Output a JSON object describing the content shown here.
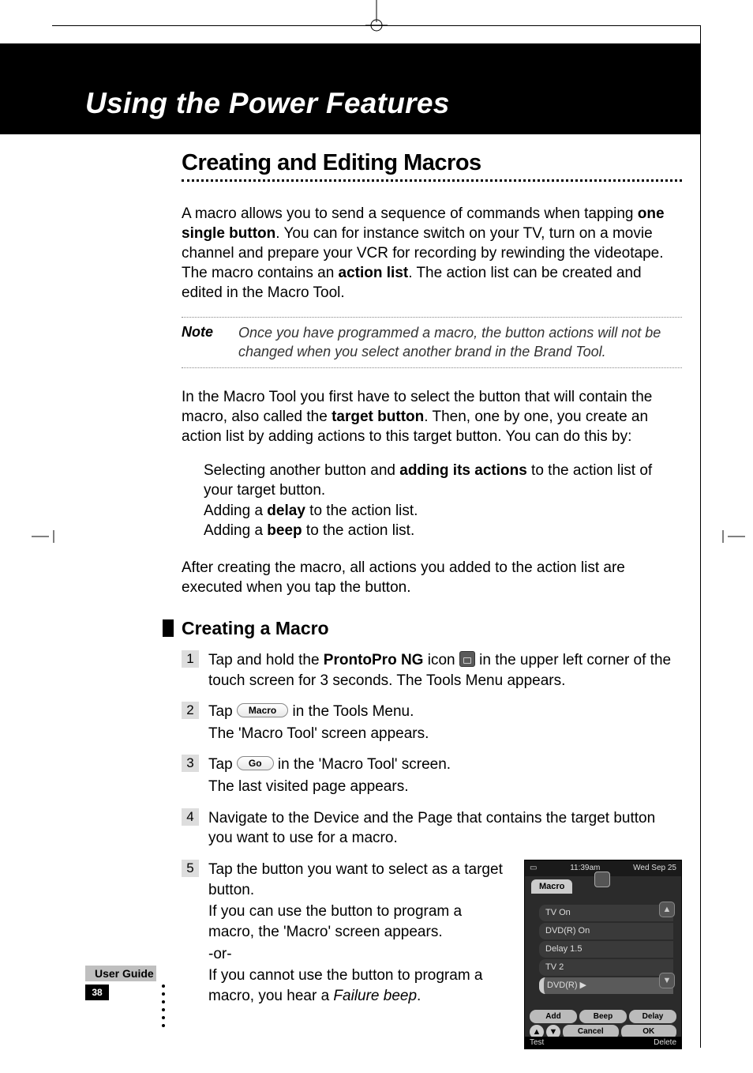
{
  "chapter_title": "Using the Power Features",
  "section_title": "Creating and Editing Macros",
  "intro": {
    "p1_a": "A macro allows you to send a sequence of commands when tapping ",
    "p1_b": "one single button",
    "p1_c": ". You can for instance switch on your TV, turn on a movie channel and prepare your VCR for recording by rewinding the videotape. The macro contains an ",
    "p1_d": "action list",
    "p1_e": ". The action list can be created and edited in the Macro Tool."
  },
  "note": {
    "label": "Note",
    "text": "Once you have programmed a macro, the button actions will not be changed when you select another brand in the Brand Tool."
  },
  "p2_a": "In the Macro Tool you first have to select the button that will contain the macro, also called the ",
  "p2_b": "target button",
  "p2_c": ". Then, one by one, you create an action list by adding actions to this target button. You can do this by:",
  "bullets": {
    "b1_a": "Selecting another button and ",
    "b1_b": "adding its actions",
    "b1_c": " to the action list of your target button.",
    "b2_a": "Adding a ",
    "b2_b": "delay",
    "b2_c": " to the action list.",
    "b3_a": "Adding a ",
    "b3_b": "beep",
    "b3_c": " to the action list."
  },
  "p3": "After creating the macro, all actions you added to the action list are executed when you tap the button.",
  "subheading": "Creating a Macro",
  "steps": {
    "s1": {
      "num": "1",
      "a": "Tap and hold the ",
      "b": "ProntoPro NG",
      "c": " icon ",
      "d": " in the upper left corner of the touch screen for 3 seconds.",
      "sub": " The Tools Menu appears."
    },
    "s2": {
      "num": "2",
      "a": "Tap ",
      "btn": "Macro",
      "b": " in the Tools Menu.",
      "sub": "The 'Macro Tool' screen appears."
    },
    "s3": {
      "num": "3",
      "a": "Tap ",
      "btn": "Go",
      "b": " in the 'Macro Tool' screen.",
      "sub": "The last visited page appears."
    },
    "s4": {
      "num": "4",
      "a": "Navigate to the Device and the Page that contains the target button you want to use for a macro."
    },
    "s5": {
      "num": "5",
      "a": "Tap the button you want to select as a target button.",
      "sub1": "If you can use the button to program a macro, the 'Macro' screen appears.",
      "or": "-or-",
      "sub2_a": "If you cannot use the button to program a macro, you hear a ",
      "sub2_b": "Failure beep",
      "sub2_c": "."
    }
  },
  "device": {
    "time": "11:39am",
    "date": "Wed Sep 25",
    "tab": "Macro",
    "items": [
      "TV On",
      "DVD(R) On",
      "Delay 1.5",
      "TV 2",
      "DVD(R)  ▶"
    ],
    "btns": [
      "Add",
      "Beep",
      "Delay"
    ],
    "bottom": {
      "cancel": "Cancel",
      "ok": "OK"
    },
    "footer": {
      "left": "Test",
      "right": "Delete"
    }
  },
  "footer": {
    "guide": "User Guide",
    "page": "38"
  }
}
